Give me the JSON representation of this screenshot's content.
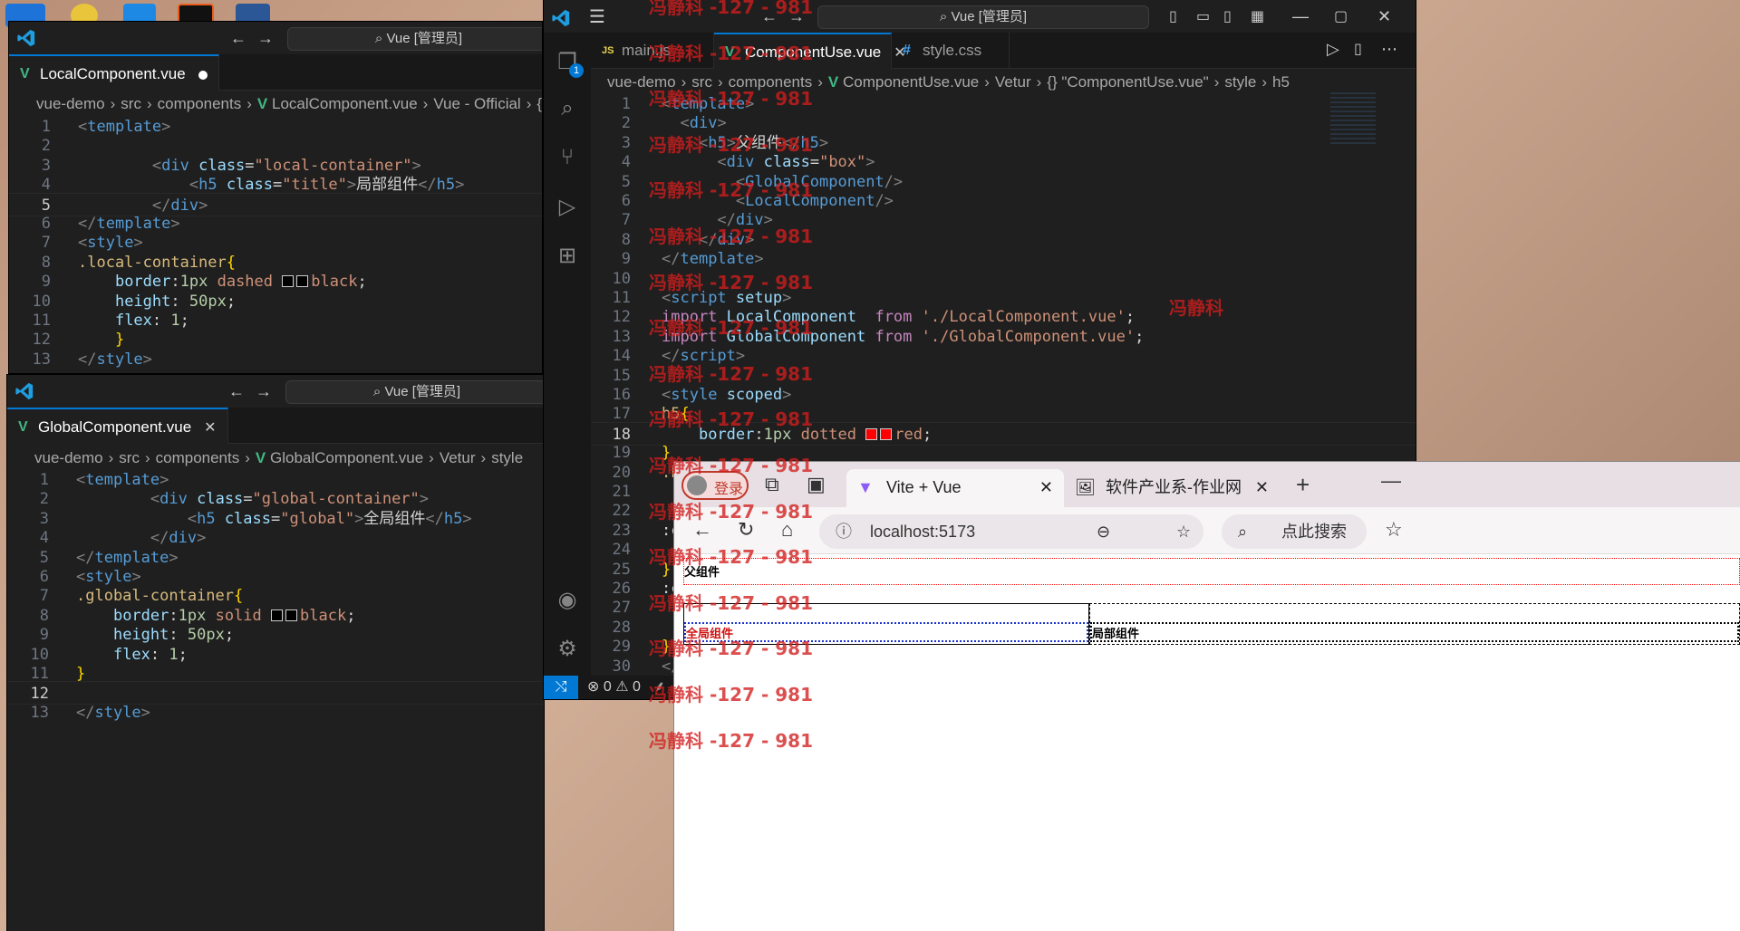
{
  "win_local": {
    "search": "Vue [管理员]",
    "tab": "LocalComponent.vue",
    "crumbs": [
      "vue-demo",
      "src",
      "components",
      "LocalComponent.vue",
      "Vue - Official",
      "{} template"
    ],
    "lines": [
      [
        {
          "c": "t-tag",
          "t": "<"
        },
        {
          "c": "t-name",
          "t": "template"
        },
        {
          "c": "t-tag",
          "t": ">"
        }
      ],
      [],
      [
        {
          "c": "t-plain",
          "t": "        "
        },
        {
          "c": "t-tag",
          "t": "<"
        },
        {
          "c": "t-name",
          "t": "div"
        },
        {
          "c": "t-plain",
          "t": " "
        },
        {
          "c": "t-attr",
          "t": "class"
        },
        {
          "c": "t-plain",
          "t": "="
        },
        {
          "c": "t-str",
          "t": "\"local-container\""
        },
        {
          "c": "t-tag",
          "t": ">"
        }
      ],
      [
        {
          "c": "t-plain",
          "t": "            "
        },
        {
          "c": "t-tag",
          "t": "<"
        },
        {
          "c": "t-name",
          "t": "h5"
        },
        {
          "c": "t-plain",
          "t": " "
        },
        {
          "c": "t-attr",
          "t": "class"
        },
        {
          "c": "t-plain",
          "t": "="
        },
        {
          "c": "t-str",
          "t": "\"title\""
        },
        {
          "c": "t-tag",
          "t": ">"
        },
        {
          "c": "t-plain",
          "t": "局部组件"
        },
        {
          "c": "t-tag",
          "t": "</"
        },
        {
          "c": "t-name",
          "t": "h5"
        },
        {
          "c": "t-tag",
          "t": ">"
        }
      ],
      [
        {
          "c": "t-plain",
          "t": "        "
        },
        {
          "c": "t-tag",
          "t": "</"
        },
        {
          "c": "t-name",
          "t": "div"
        },
        {
          "c": "t-tag",
          "t": ">"
        }
      ],
      [
        {
          "c": "t-tag",
          "t": "</"
        },
        {
          "c": "t-name",
          "t": "template"
        },
        {
          "c": "t-tag",
          "t": ">"
        }
      ],
      [
        {
          "c": "t-tag",
          "t": "<"
        },
        {
          "c": "t-name",
          "t": "style"
        },
        {
          "c": "t-tag",
          "t": ">"
        }
      ],
      [
        {
          "c": "t-sel",
          "t": ".local-container"
        },
        {
          "c": "t-brace",
          "t": "{"
        }
      ],
      [
        {
          "c": "t-plain",
          "t": "    "
        },
        {
          "c": "t-prop",
          "t": "border"
        },
        {
          "c": "t-plain",
          "t": ":"
        },
        {
          "c": "t-num",
          "t": "1px"
        },
        {
          "c": "t-plain",
          "t": " "
        },
        {
          "c": "t-val",
          "t": "dashed "
        },
        {
          "c": "sw",
          "t": "#000000"
        },
        {
          "c": "sw",
          "t": "#000000"
        },
        {
          "c": "t-val",
          "t": "black"
        },
        {
          "c": "t-plain",
          "t": ";"
        }
      ],
      [
        {
          "c": "t-plain",
          "t": "    "
        },
        {
          "c": "t-prop",
          "t": "height"
        },
        {
          "c": "t-plain",
          "t": ": "
        },
        {
          "c": "t-num",
          "t": "50px"
        },
        {
          "c": "t-plain",
          "t": ";"
        }
      ],
      [
        {
          "c": "t-plain",
          "t": "    "
        },
        {
          "c": "t-prop",
          "t": "flex"
        },
        {
          "c": "t-plain",
          "t": ": "
        },
        {
          "c": "t-num",
          "t": "1"
        },
        {
          "c": "t-plain",
          "t": ";"
        }
      ],
      [
        {
          "c": "t-plain",
          "t": "    "
        },
        {
          "c": "t-brace",
          "t": "}"
        }
      ],
      [
        {
          "c": "t-tag",
          "t": "</"
        },
        {
          "c": "t-name",
          "t": "style"
        },
        {
          "c": "t-tag",
          "t": ">"
        }
      ]
    ],
    "line_numbers": [
      "1",
      "2",
      "3",
      "4",
      "5",
      "6",
      "7",
      "8",
      "9",
      "10",
      "11",
      "12",
      "13"
    ],
    "current_line": "5"
  },
  "win_global": {
    "search": "Vue [管理员]",
    "tab": "GlobalComponent.vue",
    "crumbs": [
      "vue-demo",
      "src",
      "components",
      "GlobalComponent.vue",
      "Vetur",
      "style"
    ],
    "lines": [
      [
        {
          "c": "t-tag",
          "t": "<"
        },
        {
          "c": "t-name",
          "t": "template"
        },
        {
          "c": "t-tag",
          "t": ">"
        }
      ],
      [
        {
          "c": "t-plain",
          "t": "        "
        },
        {
          "c": "t-tag",
          "t": "<"
        },
        {
          "c": "t-name",
          "t": "div"
        },
        {
          "c": "t-plain",
          "t": " "
        },
        {
          "c": "t-attr",
          "t": "class"
        },
        {
          "c": "t-plain",
          "t": "="
        },
        {
          "c": "t-str",
          "t": "\"global-container\""
        },
        {
          "c": "t-tag",
          "t": ">"
        }
      ],
      [
        {
          "c": "t-plain",
          "t": "            "
        },
        {
          "c": "t-tag",
          "t": "<"
        },
        {
          "c": "t-name",
          "t": "h5"
        },
        {
          "c": "t-plain",
          "t": " "
        },
        {
          "c": "t-attr",
          "t": "class"
        },
        {
          "c": "t-plain",
          "t": "="
        },
        {
          "c": "t-str",
          "t": "\"global\""
        },
        {
          "c": "t-tag",
          "t": ">"
        },
        {
          "c": "t-plain",
          "t": "全局组件"
        },
        {
          "c": "t-tag",
          "t": "</"
        },
        {
          "c": "t-name",
          "t": "h5"
        },
        {
          "c": "t-tag",
          "t": ">"
        }
      ],
      [
        {
          "c": "t-plain",
          "t": "        "
        },
        {
          "c": "t-tag",
          "t": "</"
        },
        {
          "c": "t-name",
          "t": "div"
        },
        {
          "c": "t-tag",
          "t": ">"
        }
      ],
      [
        {
          "c": "t-tag",
          "t": "</"
        },
        {
          "c": "t-name",
          "t": "template"
        },
        {
          "c": "t-tag",
          "t": ">"
        }
      ],
      [
        {
          "c": "t-tag",
          "t": "<"
        },
        {
          "c": "t-name",
          "t": "style"
        },
        {
          "c": "t-tag",
          "t": ">"
        }
      ],
      [
        {
          "c": "t-sel",
          "t": ".global-container"
        },
        {
          "c": "t-brace",
          "t": "{"
        }
      ],
      [
        {
          "c": "t-plain",
          "t": "    "
        },
        {
          "c": "t-prop",
          "t": "border"
        },
        {
          "c": "t-plain",
          "t": ":"
        },
        {
          "c": "t-num",
          "t": "1px"
        },
        {
          "c": "t-plain",
          "t": " "
        },
        {
          "c": "t-val",
          "t": "solid "
        },
        {
          "c": "sw",
          "t": "#000000"
        },
        {
          "c": "sw",
          "t": "#000000"
        },
        {
          "c": "t-val",
          "t": "black"
        },
        {
          "c": "t-plain",
          "t": ";"
        }
      ],
      [
        {
          "c": "t-plain",
          "t": "    "
        },
        {
          "c": "t-prop",
          "t": "height"
        },
        {
          "c": "t-plain",
          "t": ": "
        },
        {
          "c": "t-num",
          "t": "50px"
        },
        {
          "c": "t-plain",
          "t": ";"
        }
      ],
      [
        {
          "c": "t-plain",
          "t": "    "
        },
        {
          "c": "t-prop",
          "t": "flex"
        },
        {
          "c": "t-plain",
          "t": ": "
        },
        {
          "c": "t-num",
          "t": "1"
        },
        {
          "c": "t-plain",
          "t": ";"
        }
      ],
      [
        {
          "c": "t-brace",
          "t": "}"
        }
      ],
      [],
      [
        {
          "c": "t-tag",
          "t": "</"
        },
        {
          "c": "t-name",
          "t": "style"
        },
        {
          "c": "t-tag",
          "t": ">"
        }
      ]
    ],
    "line_numbers": [
      "1",
      "2",
      "3",
      "4",
      "5",
      "6",
      "7",
      "8",
      "9",
      "10",
      "11",
      "12",
      "13"
    ],
    "current_line": "12"
  },
  "win_main": {
    "search": "Vue [管理员]",
    "tabs": [
      {
        "label": "main.js",
        "icon": "JS"
      },
      {
        "label": "ComponentUse.vue",
        "icon": "V"
      },
      {
        "label": "style.css",
        "icon": "#"
      }
    ],
    "crumbs": [
      "vue-demo",
      "src",
      "components",
      "ComponentUse.vue",
      "Vetur",
      "{} \"ComponentUse.vue\"",
      "style",
      "h5"
    ],
    "badge": "1",
    "lines": [
      [
        {
          "c": "t-tag",
          "t": "<"
        },
        {
          "c": "t-name",
          "t": "template"
        },
        {
          "c": "t-tag",
          "t": ">"
        }
      ],
      [
        {
          "c": "t-plain",
          "t": "  "
        },
        {
          "c": "t-tag",
          "t": "<"
        },
        {
          "c": "t-name",
          "t": "div"
        },
        {
          "c": "t-tag",
          "t": ">"
        }
      ],
      [
        {
          "c": "t-plain",
          "t": "    "
        },
        {
          "c": "t-tag",
          "t": "<"
        },
        {
          "c": "t-name",
          "t": "h5"
        },
        {
          "c": "t-tag",
          "t": ">"
        },
        {
          "c": "t-plain",
          "t": "父组件"
        },
        {
          "c": "t-tag",
          "t": "</"
        },
        {
          "c": "t-name",
          "t": "h5"
        },
        {
          "c": "t-tag",
          "t": ">"
        }
      ],
      [
        {
          "c": "t-plain",
          "t": "      "
        },
        {
          "c": "t-tag",
          "t": "<"
        },
        {
          "c": "t-name",
          "t": "div"
        },
        {
          "c": "t-plain",
          "t": " "
        },
        {
          "c": "t-attr",
          "t": "class"
        },
        {
          "c": "t-plain",
          "t": "="
        },
        {
          "c": "t-str",
          "t": "\"box\""
        },
        {
          "c": "t-tag",
          "t": ">"
        }
      ],
      [
        {
          "c": "t-plain",
          "t": "        "
        },
        {
          "c": "t-tag",
          "t": "<"
        },
        {
          "c": "t-name",
          "t": "GlobalComponent"
        },
        {
          "c": "t-tag",
          "t": "/>"
        }
      ],
      [
        {
          "c": "t-plain",
          "t": "        "
        },
        {
          "c": "t-tag",
          "t": "<"
        },
        {
          "c": "t-name",
          "t": "LocalComponent"
        },
        {
          "c": "t-tag",
          "t": "/>"
        }
      ],
      [
        {
          "c": "t-plain",
          "t": "      "
        },
        {
          "c": "t-tag",
          "t": "</"
        },
        {
          "c": "t-name",
          "t": "div"
        },
        {
          "c": "t-tag",
          "t": ">"
        }
      ],
      [
        {
          "c": "t-plain",
          "t": "    "
        },
        {
          "c": "t-tag",
          "t": "</"
        },
        {
          "c": "t-name",
          "t": "div"
        },
        {
          "c": "t-tag",
          "t": ">"
        }
      ],
      [
        {
          "c": "t-tag",
          "t": "</"
        },
        {
          "c": "t-name",
          "t": "template"
        },
        {
          "c": "t-tag",
          "t": ">"
        }
      ],
      [],
      [
        {
          "c": "t-tag",
          "t": "<"
        },
        {
          "c": "t-name",
          "t": "script"
        },
        {
          "c": "t-plain",
          "t": " "
        },
        {
          "c": "t-attr",
          "t": "setup"
        },
        {
          "c": "t-tag",
          "t": ">"
        }
      ],
      [
        {
          "c": "t-key",
          "t": "import"
        },
        {
          "c": "t-plain",
          "t": " "
        },
        {
          "c": "t-attr",
          "t": "LocalComponent"
        },
        {
          "c": "t-plain",
          "t": "  "
        },
        {
          "c": "t-key",
          "t": "from"
        },
        {
          "c": "t-plain",
          "t": " "
        },
        {
          "c": "t-str",
          "t": "'./LocalComponent.vue'"
        },
        {
          "c": "t-plain",
          "t": ";"
        }
      ],
      [
        {
          "c": "t-key",
          "t": "import"
        },
        {
          "c": "t-plain",
          "t": " "
        },
        {
          "c": "t-attr",
          "t": "GlobalComponent"
        },
        {
          "c": "t-plain",
          "t": " "
        },
        {
          "c": "t-key",
          "t": "from"
        },
        {
          "c": "t-plain",
          "t": " "
        },
        {
          "c": "t-str",
          "t": "'./GlobalComponent.vue'"
        },
        {
          "c": "t-plain",
          "t": ";"
        }
      ],
      [
        {
          "c": "t-tag",
          "t": "</"
        },
        {
          "c": "t-name",
          "t": "script"
        },
        {
          "c": "t-tag",
          "t": ">"
        }
      ],
      [],
      [
        {
          "c": "t-tag",
          "t": "<"
        },
        {
          "c": "t-name",
          "t": "style"
        },
        {
          "c": "t-plain",
          "t": " "
        },
        {
          "c": "t-attr",
          "t": "scoped"
        },
        {
          "c": "t-tag",
          "t": ">"
        }
      ],
      [
        {
          "c": "t-sel",
          "t": "h5"
        },
        {
          "c": "t-brace",
          "t": "{"
        }
      ],
      [
        {
          "c": "t-plain",
          "t": "    "
        },
        {
          "c": "t-prop",
          "t": "border"
        },
        {
          "c": "t-plain",
          "t": ":"
        },
        {
          "c": "t-num",
          "t": "1px"
        },
        {
          "c": "t-plain",
          "t": " "
        },
        {
          "c": "t-val",
          "t": "dotted "
        },
        {
          "c": "sw",
          "t": "#ff0000"
        },
        {
          "c": "sw",
          "t": "#ff0000"
        },
        {
          "c": "t-val",
          "t": "red"
        },
        {
          "c": "t-plain",
          "t": ";"
        }
      ],
      [
        {
          "c": "t-brace",
          "t": "}"
        }
      ],
      [
        {
          "c": "t-sel",
          "t": ".b"
        }
      ],
      [],
      [],
      [
        {
          "c": "t-plain",
          "t": ":c"
        }
      ],
      [],
      [
        {
          "c": "t-brace",
          "t": "}"
        }
      ],
      [
        {
          "c": "t-plain",
          "t": ":c"
        }
      ],
      [],
      [],
      [
        {
          "c": "t-brace",
          "t": "}"
        }
      ],
      [
        {
          "c": "t-tag",
          "t": "</"
        }
      ]
    ],
    "line_numbers": [
      "1",
      "2",
      "3",
      "4",
      "5",
      "6",
      "7",
      "8",
      "9",
      "10",
      "11",
      "12",
      "13",
      "14",
      "15",
      "16",
      "17",
      "18",
      "19",
      "20",
      "21",
      "22",
      "23",
      "24",
      "25",
      "26",
      "27",
      "28",
      "29",
      "30"
    ],
    "current_line": "18",
    "status": {
      "errors": "0",
      "warnings": "0"
    }
  },
  "browser": {
    "login": "登录",
    "tabs": [
      {
        "label": "Vite + Vue"
      },
      {
        "label": "软件产业系-作业网"
      }
    ],
    "url": "localhost:5173",
    "search_placeholder": "点此搜索",
    "page": {
      "parent_title": "父组件",
      "global_title": "全局组件",
      "local_title": "局部组件"
    }
  },
  "watermark": {
    "text": "冯静科 -127 - 981",
    "name": "冯静科"
  },
  "colors": {
    "vscode_bg": "#1f1f1f",
    "accent": "#0078d4",
    "vue_green": "#41b883",
    "watermark": "#d21e1e"
  }
}
